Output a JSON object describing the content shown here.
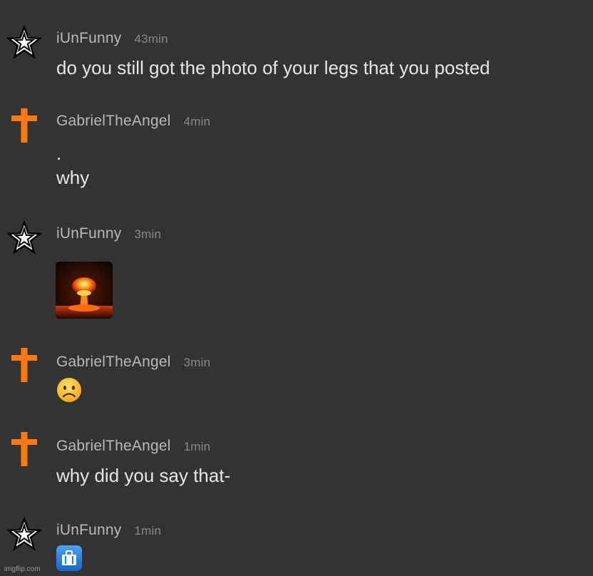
{
  "messages": [
    {
      "username": "iUnFunny",
      "time": "43min",
      "lines": [
        "do you still got the photo of your legs that you posted"
      ],
      "avatar_icon": "star-icon"
    },
    {
      "username": "GabrielTheAngel",
      "time": "4min",
      "lines": [
        ".",
        "why"
      ],
      "avatar_icon": "cross-icon"
    },
    {
      "username": "iUnFunny",
      "time": "3min",
      "attachment": "mushroom-cloud-image",
      "avatar_icon": "star-icon"
    },
    {
      "username": "GabrielTheAngel",
      "time": "3min",
      "emoji": "frowning-face-icon",
      "avatar_icon": "cross-icon"
    },
    {
      "username": "GabrielTheAngel",
      "time": "1min",
      "lines": [
        "why did you say that-"
      ],
      "avatar_icon": "cross-icon"
    },
    {
      "username": "iUnFunny",
      "time": "1min",
      "emoji": "luggage-sign-icon",
      "avatar_icon": "star-icon"
    }
  ],
  "watermark": "imgflip.com",
  "colors": {
    "background": "#333333",
    "username": "#b9b9b9",
    "timestamp": "#8a8a8a",
    "message_text": "#e6e6e6",
    "cross": "#ff7a12",
    "emoji_blue": "#1f7fe0"
  }
}
